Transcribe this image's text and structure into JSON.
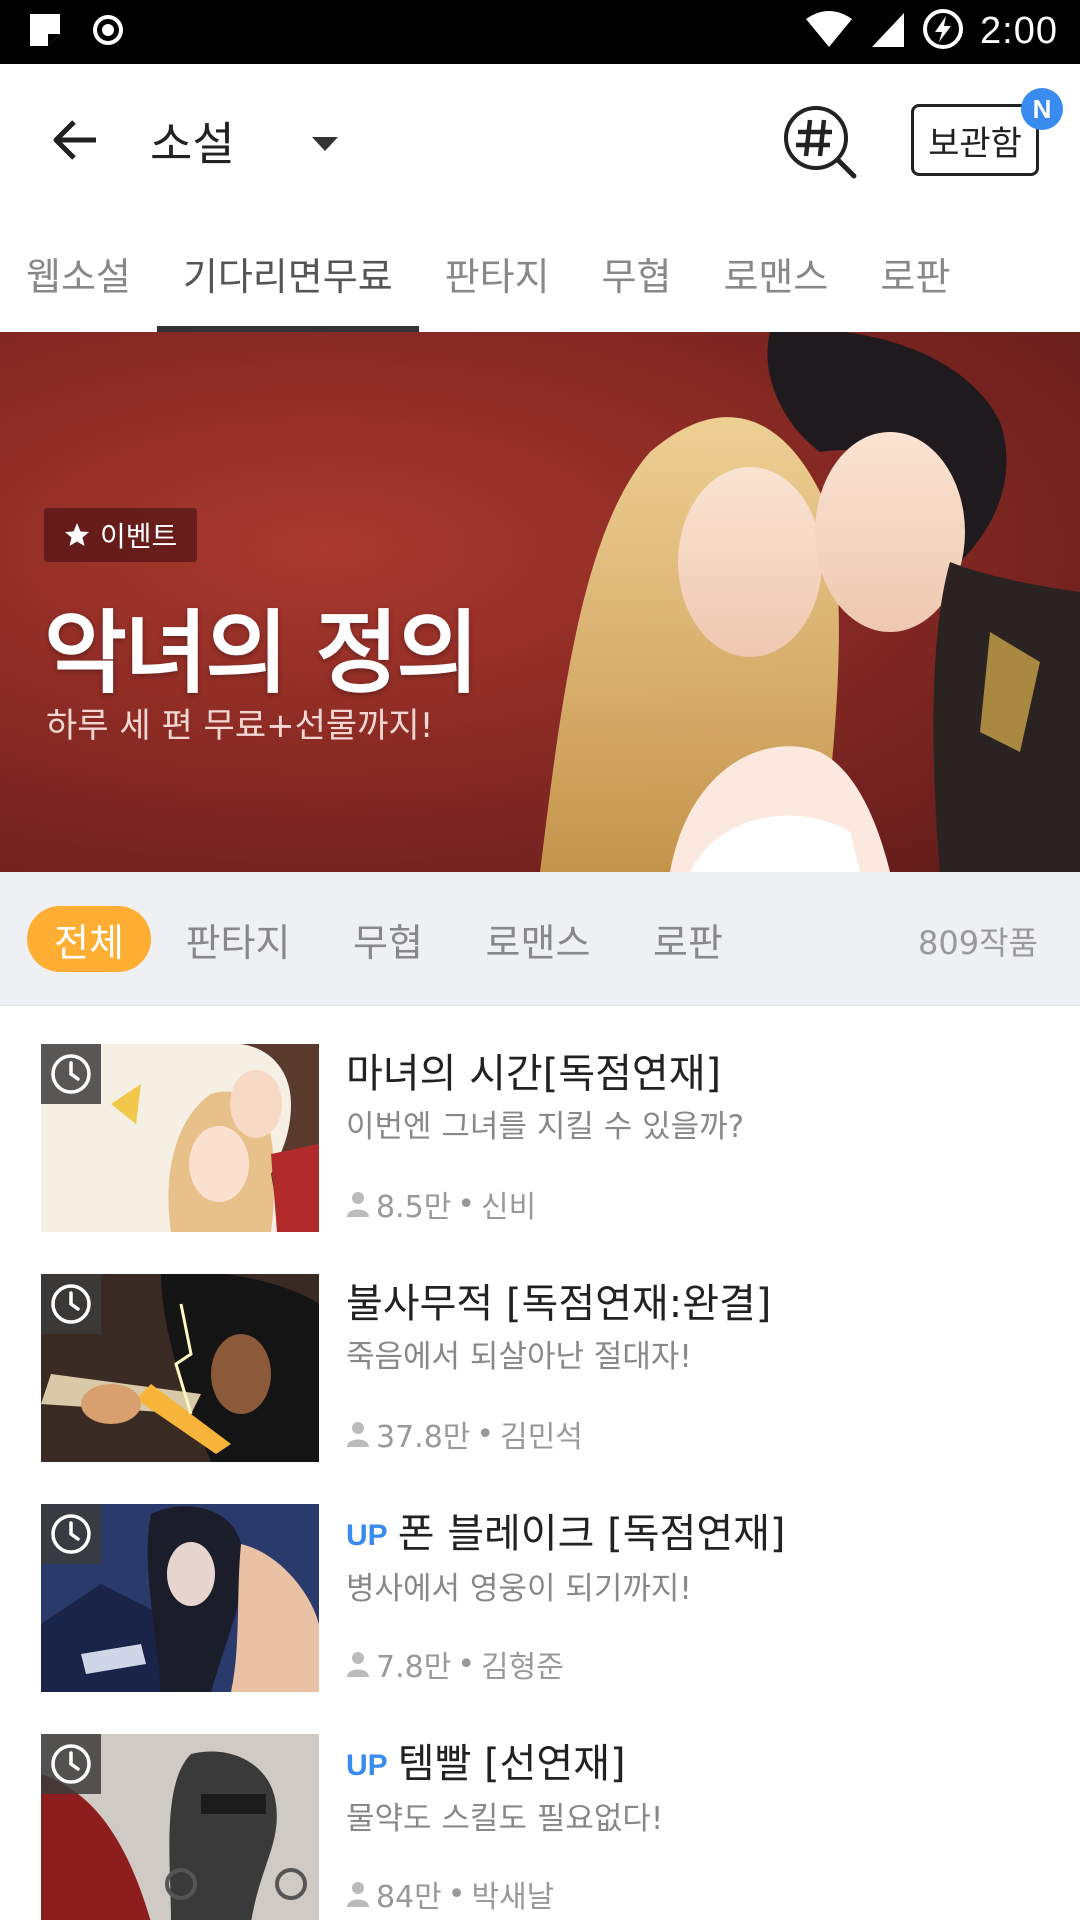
{
  "status_bar": {
    "time": "2:00"
  },
  "header": {
    "title": "소설",
    "locker_label": "보관함",
    "locker_badge": "N"
  },
  "category_tabs": [
    {
      "label": "웹소설",
      "active": false
    },
    {
      "label": "기다리면무료",
      "active": true
    },
    {
      "label": "판타지",
      "active": false
    },
    {
      "label": "무협",
      "active": false
    },
    {
      "label": "로맨스",
      "active": false
    },
    {
      "label": "로판",
      "active": false
    }
  ],
  "banner": {
    "badge": "이벤트",
    "title": "악녀의 정의",
    "subtitle": "하루 세 편 무료+선물까지!"
  },
  "filter": {
    "pills": [
      "전체",
      "판타지",
      "무협",
      "로맨스",
      "로판"
    ],
    "active": "전체",
    "count": "809작품"
  },
  "items": [
    {
      "up": "",
      "title": "마녀의 시간[독점연재]",
      "desc": "이번엔 그녀를 지킬 수 있을까?",
      "views": "8.5만",
      "author": "신비"
    },
    {
      "up": "",
      "title": "불사무적 [독점연재:완결]",
      "desc": "죽음에서 되살아난 절대자!",
      "views": "37.8만",
      "author": "김민석"
    },
    {
      "up": "UP",
      "title": "폰 블레이크 [독점연재]",
      "desc": "병사에서 영웅이 되기까지!",
      "views": "7.8만",
      "author": "김형준"
    },
    {
      "up": "UP",
      "title": "템빨 [선연재]",
      "desc": "물약도 스킬도 필요없다!",
      "views": "84만",
      "author": "박새날"
    }
  ],
  "meta_separator": " • "
}
